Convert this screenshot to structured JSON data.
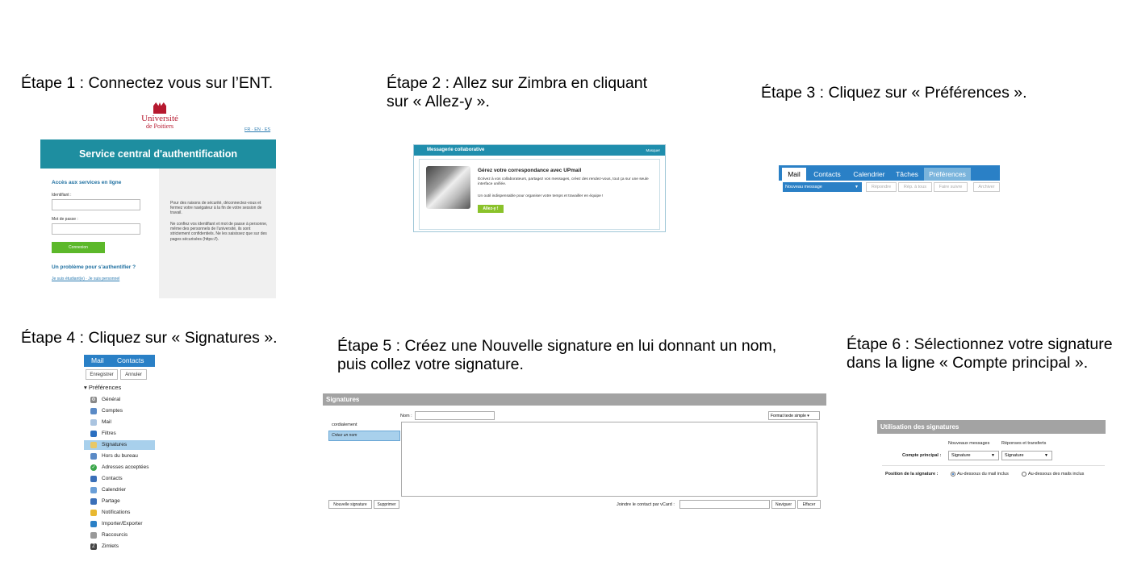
{
  "steps": {
    "s1": {
      "title": "Étape 1 : Connectez vous sur l’ENT."
    },
    "s2": {
      "title_line1": "Étape 2 : Allez sur Zimbra en cliquant",
      "title_line2": "sur « Allez-y »."
    },
    "s3": {
      "title": "Étape 3 : Cliquez sur « Préférences »."
    },
    "s4": {
      "title": "Étape 4 : Cliquez sur « Signatures »."
    },
    "s5": {
      "title_line1": "Étape 5 : Créez une Nouvelle signature en lui donnant un nom,",
      "title_line2": "puis collez votre signature."
    },
    "s6": {
      "title_line1": "Étape 6 : Sélectionnez votre signature",
      "title_line2": "dans la ligne « Compte principal »."
    }
  },
  "cas": {
    "logo_line1": "Université",
    "logo_line2": "de Poitiers",
    "lang": "FR · EN · ES",
    "banner": "Service central d'authentification",
    "heading": "Accès aux services en ligne",
    "id_label": "Identifiant :",
    "pw_label": "Mot de passe :",
    "login_button": "Connexion",
    "problem": "Un problème pour s'authentifier ?",
    "links": "Je suis étudiant(e) · Je suis personnel",
    "note1": "Pour des raisons de sécurité, déconnectez-vous et fermez votre navigateur à la fin de votre session de travail.",
    "note2": "Ne confiez vos identifiant et mot de passe à personne, même des personnels de l'université, ils sont strictement confidentiels. Ne les saisissez que sur des pages sécurisées (https://)."
  },
  "zimbra_card": {
    "bar_title": "Messagerie collaborative",
    "bar_right": "Masquer",
    "heading": "Gérez votre correspondance avec UPmail",
    "p1": "Écrivez à vos collaborateurs, partagez vos messages, créez des rendez-vous, tout ça sur une seule interface unifiée.",
    "p2": "Un outil indispensable pour organiser votre temps et travailler en équipe !",
    "go_button": "Allez-y !"
  },
  "zimbra_toolbar": {
    "tabs": [
      "Mail",
      "Contacts",
      "Calendrier",
      "Tâches",
      "Préférences"
    ],
    "new_message": "Nouveau message",
    "buttons": [
      "Répondre",
      "Rép. à tous",
      "Faire suivre",
      "Archiver"
    ]
  },
  "prefs_tree": {
    "tabs": [
      "Mail",
      "Contacts"
    ],
    "save": "Enregistrer",
    "cancel": "Annuler",
    "root": "Préférences",
    "items": [
      "Général",
      "Comptes",
      "Mail",
      "Filtres",
      "Signatures",
      "Hors du bureau",
      "Adresses acceptées",
      "Contacts",
      "Calendrier",
      "Partage",
      "Notifications",
      "Importer/Exporter",
      "Raccourcis",
      "Zimlets"
    ],
    "selected": "Signatures"
  },
  "signatures": {
    "header": "Signatures",
    "name_label": "Nom :",
    "format": "Format texte simple",
    "list_item": "cordialement",
    "new_item": "Créez un nom",
    "new_button": "Nouvelle signature",
    "delete_button": "Supprimer",
    "vcard_label": "Joindre le contact par vCard :",
    "browse": "Naviguer",
    "clear": "Effacer"
  },
  "usage": {
    "header": "Utilisation des signatures",
    "col1": "Nouveaux messages",
    "col2": "Réponses et transferts",
    "account_label": "Compte principal :",
    "sel1": "Signature",
    "sel2": "Signature",
    "position_label": "Position de la signature :",
    "opt1": "Au-dessous du mail inclus",
    "opt2": "Au-dessous des mails inclus"
  },
  "colors": {
    "zimbra_blue": "#2a80c6",
    "cas_teal": "#1e8ea0",
    "green": "#5cb82a"
  }
}
